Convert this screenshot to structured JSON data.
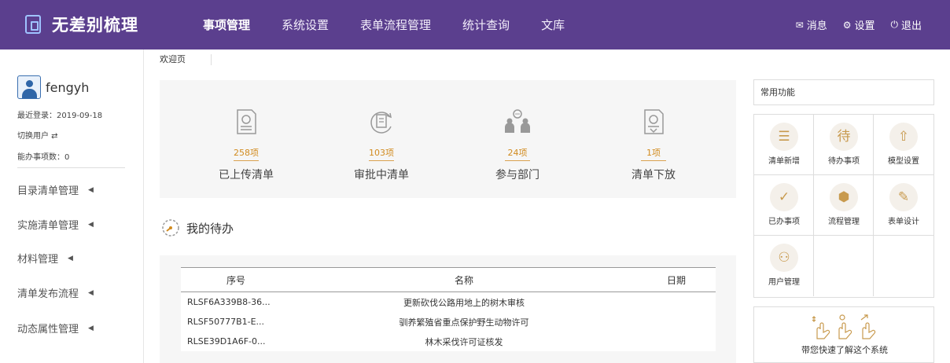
{
  "app": {
    "title": "无差别梳理"
  },
  "nav": {
    "items": [
      "事项管理",
      "系统设置",
      "表单流程管理",
      "统计查询",
      "文库"
    ]
  },
  "top_actions": {
    "messages": "消息",
    "settings": "设置",
    "logout": "退出"
  },
  "user": {
    "name": "fengyh",
    "last_login": "最近登录：2019-09-18",
    "switch_user": "切换用户 ⇄",
    "task_count": "能办事项数：0"
  },
  "sidebar": {
    "items": [
      {
        "label": "目录清单管理"
      },
      {
        "label": "实施清单管理"
      },
      {
        "label": "材料管理"
      },
      {
        "label": "清单发布流程"
      },
      {
        "label": "动态属性管理"
      }
    ]
  },
  "tabs": {
    "welcome": "欢迎页"
  },
  "stats": [
    {
      "count": "258项",
      "label": "已上传清单",
      "icon": "document-stamp-icon"
    },
    {
      "count": "103项",
      "label": "审批中清单",
      "icon": "document-refresh-icon"
    },
    {
      "count": "24项",
      "label": "参与部门",
      "icon": "people-group-icon"
    },
    {
      "count": "1项",
      "label": "清单下放",
      "icon": "document-download-icon"
    }
  ],
  "todo": {
    "title": "我的待办",
    "columns": {
      "no": "序号",
      "name": "名称",
      "date": "日期"
    },
    "rows": [
      {
        "no": "RLSF6A339B8-36...",
        "name": "更新砍伐公路用地上的树木审核",
        "date": ""
      },
      {
        "no": "RLSF50777B1-E...",
        "name": "驯养繁殖省重点保护野生动物许可",
        "date": ""
      },
      {
        "no": "RLSE39D1A6F-0...",
        "name": "林木采伐许可证核发",
        "date": ""
      }
    ]
  },
  "quick": {
    "title": "常用功能",
    "items": [
      {
        "label": "清单新增",
        "icon": "list-add-icon",
        "glyph": "☰"
      },
      {
        "label": "待办事项",
        "icon": "pending-icon",
        "glyph": "待"
      },
      {
        "label": "模型设置",
        "icon": "model-upload-icon",
        "glyph": "⇧"
      },
      {
        "label": "已办事项",
        "icon": "check-circle-icon",
        "glyph": "✓"
      },
      {
        "label": "流程管理",
        "icon": "flow-shield-icon",
        "glyph": "⬢"
      },
      {
        "label": "表单设计",
        "icon": "form-pen-icon",
        "glyph": "✎"
      },
      {
        "label": "用户管理",
        "icon": "users-icon",
        "glyph": "⚇"
      }
    ]
  },
  "tour": {
    "text": "带您快速了解这个系统"
  },
  "colors": {
    "brand": "#5b3f8e",
    "accent": "#d18b1f"
  }
}
